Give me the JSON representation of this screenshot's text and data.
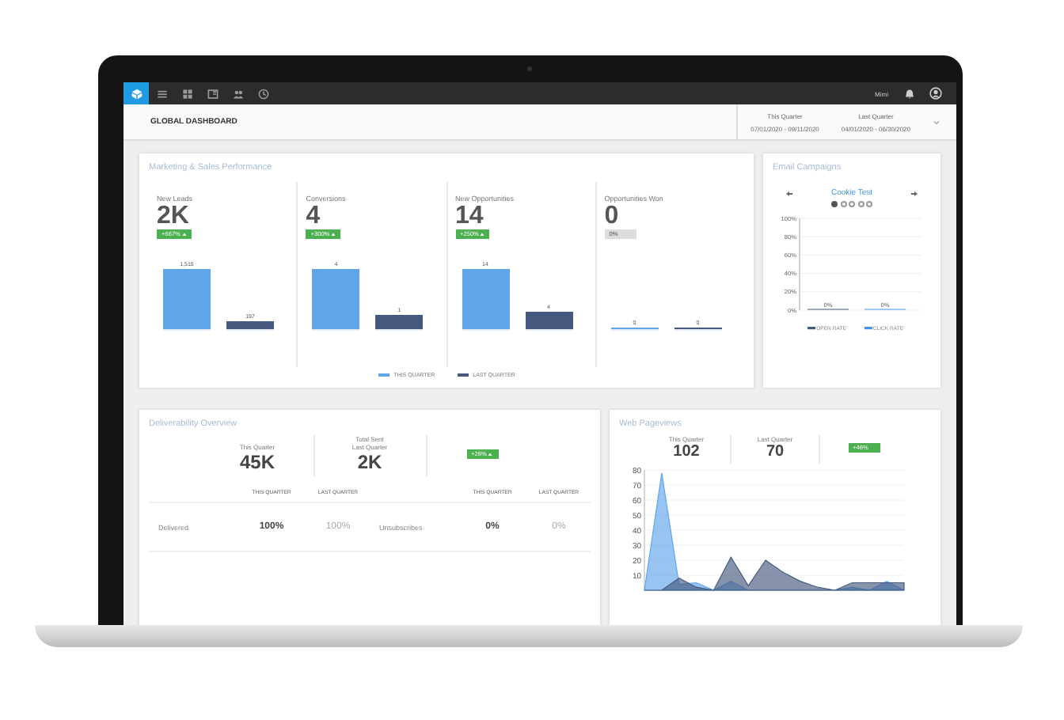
{
  "nav": {
    "icons": [
      {
        "kind": "cube",
        "selected": true
      },
      {
        "kind": "list",
        "selected": false
      },
      {
        "kind": "grid",
        "selected": false
      },
      {
        "kind": "card",
        "selected": false
      },
      {
        "kind": "people",
        "selected": false
      },
      {
        "kind": "clock",
        "selected": false
      }
    ],
    "user": "Mimi"
  },
  "header": {
    "title": "GLOBAL DASHBOARD",
    "periods": [
      {
        "label": "This Quarter",
        "range": "07/01/2020 - 09/11/2020"
      },
      {
        "label": "Last Quarter",
        "range": "04/01/2020 - 06/30/2020"
      }
    ]
  },
  "performance": {
    "title": "Marketing & Sales Performance",
    "metrics": [
      {
        "label": "New Leads",
        "value": "2K",
        "badge": {
          "text": "+667%",
          "positive": true
        },
        "bars": [
          {
            "value": "1,515",
            "level": 1,
            "color": "#5fa5ea"
          },
          {
            "value": "197",
            "level": 0.13,
            "color": "#45597e"
          }
        ]
      },
      {
        "label": "Conversions",
        "value": "4",
        "badge": {
          "text": "+300%",
          "positive": true
        },
        "bars": [
          {
            "value": "4",
            "level": 1,
            "color": "#5fa5ea"
          },
          {
            "value": "1",
            "level": 0.25,
            "color": "#45597e"
          }
        ]
      },
      {
        "label": "New Opportunities",
        "value": "14",
        "badge": {
          "text": "+250%",
          "positive": true
        },
        "bars": [
          {
            "value": "14",
            "level": 1,
            "color": "#5fa5ea"
          },
          {
            "value": "4",
            "level": 0.29,
            "color": "#45597e"
          }
        ]
      },
      {
        "label": "Opportunities Won",
        "value": "0",
        "badge": {
          "text": "0%",
          "positive": false
        },
        "bars": [
          {
            "value": "0",
            "level": 0,
            "color": "#5fa5ea"
          },
          {
            "value": "0",
            "level": 0,
            "color": "#45597e"
          }
        ]
      }
    ],
    "legend": [
      {
        "label": "THIS QUARTER",
        "color": "#5fa5ea"
      },
      {
        "label": "LAST QUARTER",
        "color": "#45597e"
      }
    ]
  },
  "email": {
    "title": "Email Campaigns",
    "campaign": "Cookie Test",
    "dots": [
      {
        "selected": true
      },
      {
        "selected": false
      },
      {
        "selected": false
      },
      {
        "selected": false
      },
      {
        "selected": false
      }
    ],
    "chart_data": {
      "type": "bar",
      "categories": [
        "OPEN RATE",
        "CLICK RATE"
      ],
      "series": [
        {
          "values": [
            0,
            0
          ]
        }
      ],
      "ylim": [
        0,
        100
      ],
      "yticks": [
        {
          "value": 0,
          "label": "0%"
        },
        {
          "value": 20,
          "label": "20%"
        },
        {
          "value": 40,
          "label": "40%"
        },
        {
          "value": 60,
          "label": "60%"
        },
        {
          "value": 80,
          "label": "80%"
        },
        {
          "value": 100,
          "label": "100%"
        }
      ],
      "grid": true,
      "value_labels": [
        "0%",
        "0%"
      ]
    },
    "legend": [
      {
        "color": "#45597e"
      },
      {
        "color": "#3f95ee"
      }
    ]
  },
  "deliverability": {
    "title": "Deliverability Overview",
    "total_label": "Total Sent",
    "summary": [
      {
        "label": "This Quarter",
        "value": "45K"
      },
      {
        "label": "Last Quarter",
        "value": "2K"
      }
    ],
    "badge": {
      "text": "+26%",
      "positive": true
    },
    "groups": [
      {
        "headers": [
          "THIS QUARTER",
          "LAST QUARTER"
        ],
        "metric": "Delivered",
        "this": "100%",
        "last": "100%"
      },
      {
        "headers": [
          "THIS QUARTER",
          "LAST QUARTER"
        ],
        "metric": "Unsubscribes",
        "this": "0%",
        "last": "0%"
      }
    ]
  },
  "pageviews": {
    "title": "Web Pageviews",
    "summary": [
      {
        "label": "This Quarter",
        "value": "102"
      },
      {
        "label": "Last Quarter",
        "value": "70"
      }
    ],
    "badge": {
      "text": "+46%",
      "positive": true
    },
    "axis_labels": [
      "80",
      "70",
      "60",
      "50",
      "40",
      "30",
      "20",
      "10"
    ]
  }
}
